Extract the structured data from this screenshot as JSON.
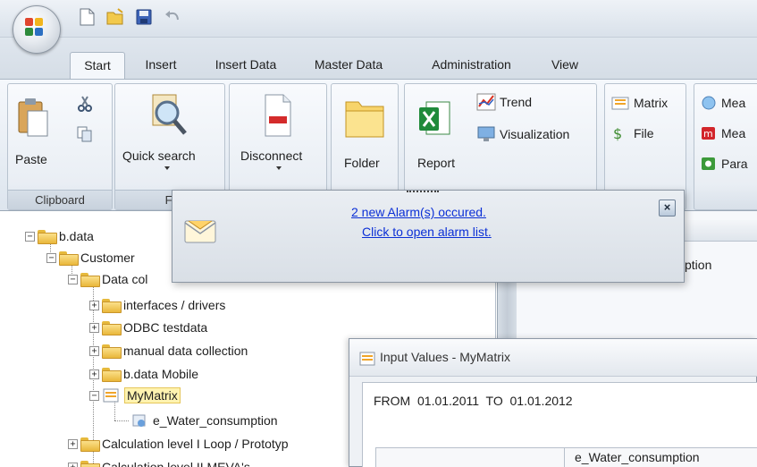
{
  "ribbon_tabs": [
    {
      "label": "Start",
      "active": true
    },
    {
      "label": "Insert",
      "active": false
    },
    {
      "label": "Insert Data",
      "active": false
    },
    {
      "label": "Master Data",
      "active": false
    },
    {
      "label": "Administration",
      "active": false
    },
    {
      "label": "View",
      "active": false
    }
  ],
  "ribbon": {
    "clipboard": {
      "paste": "Paste",
      "group_label": "Clipboard"
    },
    "find": {
      "quick_search": "Quick search",
      "group_label": "Fi"
    },
    "disconnect": {
      "label": "Disconnect"
    },
    "folder": {
      "label": "Folder"
    },
    "report_group": {
      "report": "Report",
      "trend": "Trend",
      "visualization": "Visualization"
    },
    "matrix_group": {
      "matrix": "Matrix",
      "file": "File"
    },
    "measure_group": {
      "item1": "Mea",
      "item2": "Mea",
      "item3": "Para"
    }
  },
  "alarm_popup": {
    "line1": "2 new Alarm(s) occured.",
    "line2": "Click to open alarm list.",
    "close": "×"
  },
  "tree": {
    "root": "b.data",
    "customer": "Customer",
    "data_collection": "Data col",
    "items": [
      "interfaces / drivers",
      "ODBC testdata",
      "manual data collection",
      "b.data Mobile"
    ],
    "selected": "MyMatrix",
    "child": "e_Water_consumption",
    "calc1": "Calculation level I Loop / Prototyp",
    "calc2": "Calculation level II MEVA's"
  },
  "right_panel": {
    "column_partial": "ption"
  },
  "input_window": {
    "title": "Input Values - MyMatrix",
    "range": "FROM  01.01.2011  TO  01.01.2012",
    "column_header": "e_Water_consumption"
  },
  "colors": {
    "link": "#0b2fd6",
    "selected_bg": "#fff3b0",
    "folder": "#f1c94f"
  }
}
